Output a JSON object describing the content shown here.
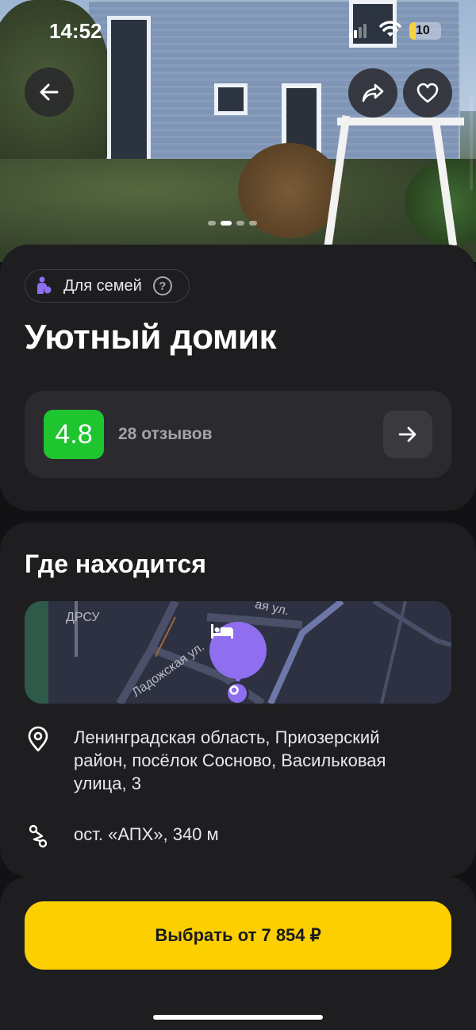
{
  "status_bar": {
    "time": "14:52",
    "battery": "10"
  },
  "hero": {
    "back_icon": "arrow-left-icon",
    "share_icon": "share-icon",
    "favorite_icon": "heart-icon",
    "photo_count_pages": 4,
    "active_page": 1
  },
  "header": {
    "badge_label": "Для семей",
    "badge_help": "?",
    "title": "Уютный домик"
  },
  "rating": {
    "score": "4.8",
    "reviews": "28 отзывов",
    "score_color": "#1ec52f"
  },
  "location": {
    "section_title": "Где находится",
    "map_labels": {
      "drsu": "ДРСУ",
      "street1": "Ладожская ул.",
      "street2": "ая ул."
    },
    "address": "Ленинградская область, Приозерский район, посёлок Сосново, Васильковая улица, 3",
    "transit": "ост. «АПХ», 340 м",
    "pin_color": "#8f6ff0"
  },
  "cta": {
    "label": "Выбрать от 7 854 ₽",
    "color": "#fbcf00"
  }
}
